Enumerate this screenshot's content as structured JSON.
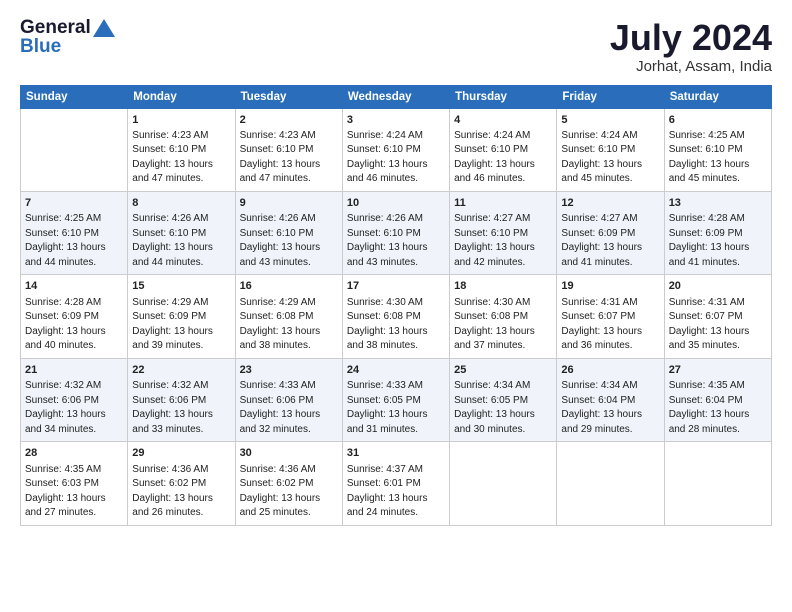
{
  "header": {
    "logo_line1": "General",
    "logo_line2": "Blue",
    "title": "July 2024",
    "subtitle": "Jorhat, Assam, India"
  },
  "calendar": {
    "days_of_week": [
      "Sunday",
      "Monday",
      "Tuesday",
      "Wednesday",
      "Thursday",
      "Friday",
      "Saturday"
    ],
    "weeks": [
      [
        {
          "day": "",
          "content": ""
        },
        {
          "day": "1",
          "content": "Sunrise: 4:23 AM\nSunset: 6:10 PM\nDaylight: 13 hours\nand 47 minutes."
        },
        {
          "day": "2",
          "content": "Sunrise: 4:23 AM\nSunset: 6:10 PM\nDaylight: 13 hours\nand 47 minutes."
        },
        {
          "day": "3",
          "content": "Sunrise: 4:24 AM\nSunset: 6:10 PM\nDaylight: 13 hours\nand 46 minutes."
        },
        {
          "day": "4",
          "content": "Sunrise: 4:24 AM\nSunset: 6:10 PM\nDaylight: 13 hours\nand 46 minutes."
        },
        {
          "day": "5",
          "content": "Sunrise: 4:24 AM\nSunset: 6:10 PM\nDaylight: 13 hours\nand 45 minutes."
        },
        {
          "day": "6",
          "content": "Sunrise: 4:25 AM\nSunset: 6:10 PM\nDaylight: 13 hours\nand 45 minutes."
        }
      ],
      [
        {
          "day": "7",
          "content": "Sunrise: 4:25 AM\nSunset: 6:10 PM\nDaylight: 13 hours\nand 44 minutes."
        },
        {
          "day": "8",
          "content": "Sunrise: 4:26 AM\nSunset: 6:10 PM\nDaylight: 13 hours\nand 44 minutes."
        },
        {
          "day": "9",
          "content": "Sunrise: 4:26 AM\nSunset: 6:10 PM\nDaylight: 13 hours\nand 43 minutes."
        },
        {
          "day": "10",
          "content": "Sunrise: 4:26 AM\nSunset: 6:10 PM\nDaylight: 13 hours\nand 43 minutes."
        },
        {
          "day": "11",
          "content": "Sunrise: 4:27 AM\nSunset: 6:10 PM\nDaylight: 13 hours\nand 42 minutes."
        },
        {
          "day": "12",
          "content": "Sunrise: 4:27 AM\nSunset: 6:09 PM\nDaylight: 13 hours\nand 41 minutes."
        },
        {
          "day": "13",
          "content": "Sunrise: 4:28 AM\nSunset: 6:09 PM\nDaylight: 13 hours\nand 41 minutes."
        }
      ],
      [
        {
          "day": "14",
          "content": "Sunrise: 4:28 AM\nSunset: 6:09 PM\nDaylight: 13 hours\nand 40 minutes."
        },
        {
          "day": "15",
          "content": "Sunrise: 4:29 AM\nSunset: 6:09 PM\nDaylight: 13 hours\nand 39 minutes."
        },
        {
          "day": "16",
          "content": "Sunrise: 4:29 AM\nSunset: 6:08 PM\nDaylight: 13 hours\nand 38 minutes."
        },
        {
          "day": "17",
          "content": "Sunrise: 4:30 AM\nSunset: 6:08 PM\nDaylight: 13 hours\nand 38 minutes."
        },
        {
          "day": "18",
          "content": "Sunrise: 4:30 AM\nSunset: 6:08 PM\nDaylight: 13 hours\nand 37 minutes."
        },
        {
          "day": "19",
          "content": "Sunrise: 4:31 AM\nSunset: 6:07 PM\nDaylight: 13 hours\nand 36 minutes."
        },
        {
          "day": "20",
          "content": "Sunrise: 4:31 AM\nSunset: 6:07 PM\nDaylight: 13 hours\nand 35 minutes."
        }
      ],
      [
        {
          "day": "21",
          "content": "Sunrise: 4:32 AM\nSunset: 6:06 PM\nDaylight: 13 hours\nand 34 minutes."
        },
        {
          "day": "22",
          "content": "Sunrise: 4:32 AM\nSunset: 6:06 PM\nDaylight: 13 hours\nand 33 minutes."
        },
        {
          "day": "23",
          "content": "Sunrise: 4:33 AM\nSunset: 6:06 PM\nDaylight: 13 hours\nand 32 minutes."
        },
        {
          "day": "24",
          "content": "Sunrise: 4:33 AM\nSunset: 6:05 PM\nDaylight: 13 hours\nand 31 minutes."
        },
        {
          "day": "25",
          "content": "Sunrise: 4:34 AM\nSunset: 6:05 PM\nDaylight: 13 hours\nand 30 minutes."
        },
        {
          "day": "26",
          "content": "Sunrise: 4:34 AM\nSunset: 6:04 PM\nDaylight: 13 hours\nand 29 minutes."
        },
        {
          "day": "27",
          "content": "Sunrise: 4:35 AM\nSunset: 6:04 PM\nDaylight: 13 hours\nand 28 minutes."
        }
      ],
      [
        {
          "day": "28",
          "content": "Sunrise: 4:35 AM\nSunset: 6:03 PM\nDaylight: 13 hours\nand 27 minutes."
        },
        {
          "day": "29",
          "content": "Sunrise: 4:36 AM\nSunset: 6:02 PM\nDaylight: 13 hours\nand 26 minutes."
        },
        {
          "day": "30",
          "content": "Sunrise: 4:36 AM\nSunset: 6:02 PM\nDaylight: 13 hours\nand 25 minutes."
        },
        {
          "day": "31",
          "content": "Sunrise: 4:37 AM\nSunset: 6:01 PM\nDaylight: 13 hours\nand 24 minutes."
        },
        {
          "day": "",
          "content": ""
        },
        {
          "day": "",
          "content": ""
        },
        {
          "day": "",
          "content": ""
        }
      ]
    ]
  }
}
